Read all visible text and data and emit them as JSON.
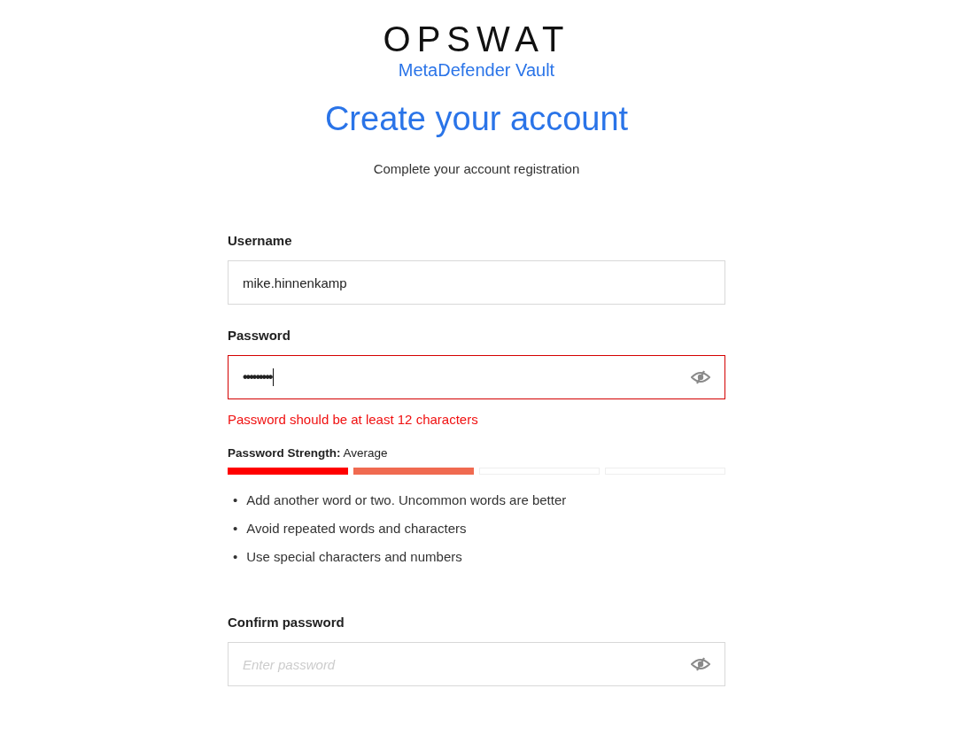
{
  "logo": {
    "wordmark": "OPSWAT",
    "product": "MetaDefender Vault"
  },
  "heading": "Create your account",
  "subtitle": "Complete your account registration",
  "fields": [
    {
      "kind": "text",
      "label": "Username",
      "value": "mike.hinnenkamp",
      "error": false
    },
    {
      "kind": "password",
      "label": "Password",
      "value": "•••••••••",
      "error": true,
      "error_text": "Password should be at least 12 characters",
      "focused": true
    },
    {
      "kind": "password",
      "label": "Confirm password",
      "placeholder": "Enter password",
      "error": false,
      "focused": false
    }
  ],
  "strength": {
    "label": "Password Strength:",
    "value": "Average",
    "segments": [
      {
        "filled": true,
        "color": "#ff0000"
      },
      {
        "filled": true,
        "color": "#f06a50"
      },
      {
        "filled": false
      },
      {
        "filled": false
      }
    ],
    "tips": [
      {
        "bullet": "•",
        "text": "Add another word or two. Uncommon words are better"
      },
      {
        "bullet": "•",
        "text": "Avoid repeated words and characters"
      },
      {
        "bullet": "•",
        "text": "Use special characters and numbers"
      }
    ]
  }
}
